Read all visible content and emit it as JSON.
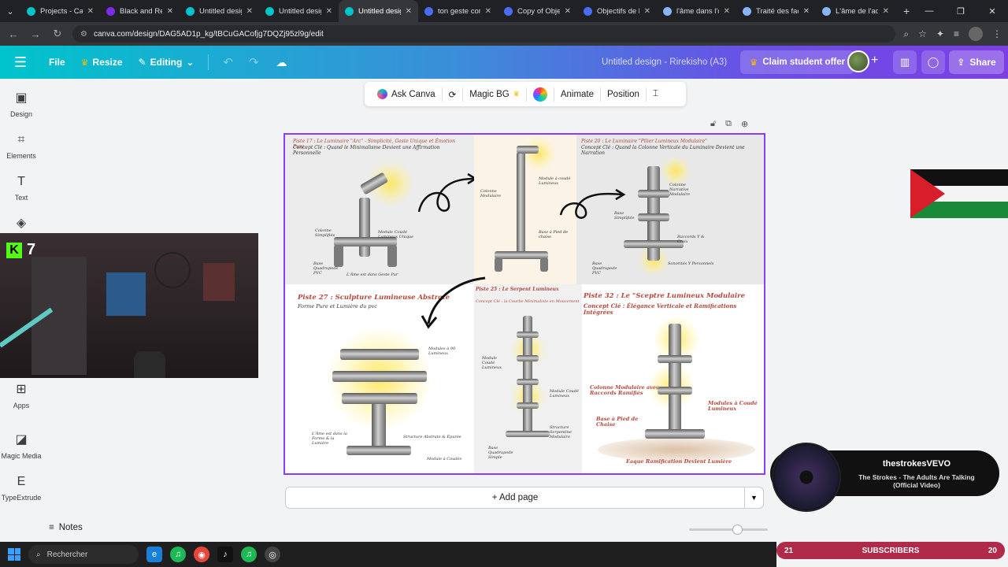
{
  "browser": {
    "tabs": [
      {
        "title": "Projects - Canva",
        "active": false
      },
      {
        "title": "Black and Red",
        "active": false
      },
      {
        "title": "Untitled design",
        "active": false
      },
      {
        "title": "Untitled design",
        "active": false
      },
      {
        "title": "Untitled design",
        "active": true
      },
      {
        "title": "ton geste com",
        "active": false
      },
      {
        "title": "Copy of Object",
        "active": false
      },
      {
        "title": "Objectifs de l'é",
        "active": false
      },
      {
        "title": "l'âme dans l'ob",
        "active": false
      },
      {
        "title": "Traité des facul",
        "active": false
      },
      {
        "title": "L'âme de l'ado",
        "active": false
      }
    ],
    "url": "canva.com/design/DAG5AD1p_kg/tBCuGACofjg7DQZj95zl9g/edit"
  },
  "header": {
    "file": "File",
    "resize": "Resize",
    "editing": "Editing",
    "doc_title": "Untitled design - Rirekisho (A3)",
    "claim": "Claim student offer",
    "share": "Share"
  },
  "sidebar": {
    "items": [
      {
        "label": "Design",
        "icon": "design-icon"
      },
      {
        "label": "Elements",
        "icon": "elements-icon"
      },
      {
        "label": "Text",
        "icon": "text-icon"
      },
      {
        "label": "Apps",
        "icon": "apps-icon"
      },
      {
        "label": "Magic Media",
        "icon": "magic-media-icon"
      },
      {
        "label": "TypeExtrude",
        "icon": "typeextrude-icon"
      }
    ]
  },
  "webcam": {
    "kick_count": "7"
  },
  "toolbar": {
    "ask": "Ask Canva",
    "magic_bg": "Magic BG",
    "animate": "Animate",
    "position": "Position"
  },
  "canvas": {
    "p1": {
      "title": "Piste 17 : Le Luminaire \"Arc\" - Simplicité, Geste Unique et Émotion Pure",
      "concept": "Concept Clé : Quand le Minimalisme Devient une Affirmation Personnelle",
      "notes": [
        "Colonne Simplifiée",
        "Module Coudé Lumineux Unique",
        "Base Quadrupode PVC",
        "L'Âme est dans Geste Pur"
      ]
    },
    "p2": {
      "notes": [
        "Module à coudé Lumineux",
        "Colonne Modulaire",
        "Base à Pied de chaise"
      ]
    },
    "p3": {
      "title": "Piste 20 : Le Luminaire \"Pilier Lumineux Modulaire\"",
      "concept": "Concept Clé : Quand la Colonne Verticale du Luminaire Devient une Narration",
      "notes": [
        "Colonne Narrative Modulaire",
        "Base Simplifiée",
        "Raccords Y & Croix",
        "Base Quadrupode PVC",
        "Sonorités Y Personnels"
      ]
    },
    "p4": {
      "title": "Piste 27 : Sculpture Lumineuse Abstrate",
      "subtitle": "Forme Pure et Lumière du pvc",
      "notes": [
        "Modules à 90 Lumineux",
        "L'Âme est dans la Forme & la Lumière",
        "Structure Abstrate & Épurée",
        "Module à Coudés"
      ]
    },
    "p5": {
      "title": "Piste 25 : Le Serpent Lumineux",
      "concept": "Concept Clé : la Courbe Minimaliste en Mouvement",
      "notes": [
        "Module Coudé Lumineux",
        "Module Coudé Lumineux",
        "Structure Serpentine Modulaire",
        "Base Quadrupode Simple"
      ]
    },
    "p6": {
      "title": "Piste 32 : Le \"Sceptre Lumineux Modulaire",
      "concept": "Concept Clé : Élégance Verticale et Ramifications Intégrées",
      "notes": [
        "Colonne Modulaire avec Raccords Ramifiés",
        "Modules à Coudé Lumineux",
        "Base à Pied de Chaise",
        "Eaque Ramification Devient Lumière"
      ]
    }
  },
  "add_page": "+ Add page",
  "notes": "Notes",
  "music": {
    "channel": "thestrokesVEVO",
    "song": "The Strokes - The Adults Are Talking (Official Video)"
  },
  "subscribers": {
    "left": "21",
    "label": "SUBSCRIBERS",
    "right": "20"
  },
  "taskbar": {
    "search": "Rechercher"
  },
  "colors": {
    "accent": "#8b3dff",
    "header_start": "#00c4cc",
    "header_end": "#7b3fe4"
  }
}
